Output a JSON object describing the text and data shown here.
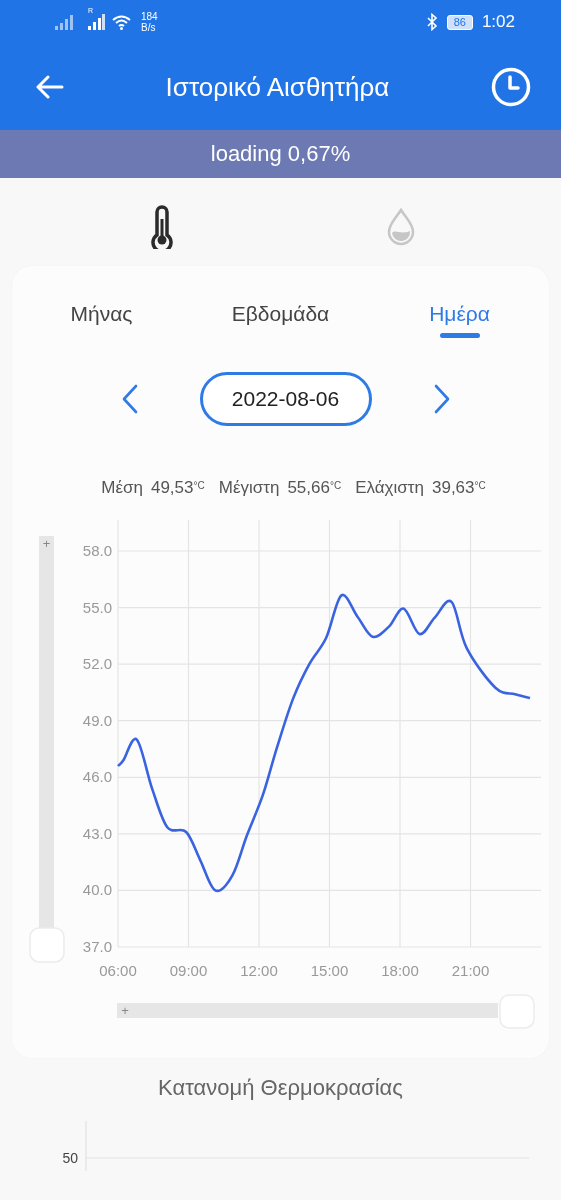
{
  "status_bar": {
    "roaming_mark": "R",
    "network_speed": "184",
    "network_speed_unit": "B/s",
    "battery": "86",
    "time": "1:02"
  },
  "app_bar": {
    "title": "Ιστορικό Αισθητήρα"
  },
  "loading_banner": {
    "text": "loading 0,67%"
  },
  "sensor_tabs": [
    {
      "kind": "thermometer",
      "selected": true
    },
    {
      "kind": "drop",
      "selected": false
    }
  ],
  "period_tabs": [
    {
      "label": "Μήνας",
      "selected": false
    },
    {
      "label": "Εβδομάδα",
      "selected": false
    },
    {
      "label": "Ημέρα",
      "selected": true
    }
  ],
  "date_picker": {
    "value": "2022-08-06"
  },
  "stats": [
    {
      "label": "Μέση",
      "value": "49,53",
      "unit": "°C"
    },
    {
      "label": "Μέγιστη",
      "value": "55,66",
      "unit": "°C"
    },
    {
      "label": "Ελάχιστη",
      "value": "39,63",
      "unit": "°C"
    }
  ],
  "chart": {
    "y_zoom_symbol": "+",
    "x_zoom_symbol": "+",
    "chart_data": {
      "type": "line",
      "x": [
        6.0,
        6.23,
        6.8,
        7.45,
        8.1,
        8.9,
        9.5,
        10.14,
        10.87,
        11.48,
        12.16,
        12.77,
        13.46,
        14.14,
        14.86,
        15.51,
        16.2,
        16.84,
        17.54,
        18.15,
        18.83,
        19.47,
        20.19,
        20.84,
        22.06,
        22.9,
        23.53
      ],
      "grid": true,
      "series": [
        {
          "color": "#3a63e0",
          "values": [
            46.6,
            46.9,
            48.0,
            45.4,
            43.35,
            43.1,
            41.6,
            40.0,
            40.8,
            42.9,
            45.05,
            47.6,
            50.2,
            52.0,
            53.4,
            55.65,
            54.5,
            53.45,
            54.0,
            54.95,
            53.6,
            54.45,
            55.3,
            52.85,
            50.75,
            50.4,
            50.2
          ]
        }
      ],
      "xlim": [
        6,
        24
      ],
      "ylim": [
        37,
        58
      ],
      "xticks": [
        {
          "value": 6,
          "label": "06:00"
        },
        {
          "value": 9,
          "label": "09:00"
        },
        {
          "value": 12,
          "label": "12:00"
        },
        {
          "value": 15,
          "label": "15:00"
        },
        {
          "value": 18,
          "label": "18:00"
        },
        {
          "value": 21,
          "label": "21:00"
        }
      ],
      "yticks": [
        {
          "value": 37,
          "label": "37.0"
        },
        {
          "value": 40,
          "label": "40.0"
        },
        {
          "value": 43,
          "label": "43.0"
        },
        {
          "value": 46,
          "label": "46.0"
        },
        {
          "value": 49,
          "label": "49.0"
        },
        {
          "value": 52,
          "label": "52.0"
        },
        {
          "value": 55,
          "label": "55.0"
        },
        {
          "value": 58,
          "label": "58.0"
        }
      ]
    }
  },
  "distribution": {
    "title": "Κατανομή Θερμοκρασίας",
    "axis_label": "50"
  }
}
